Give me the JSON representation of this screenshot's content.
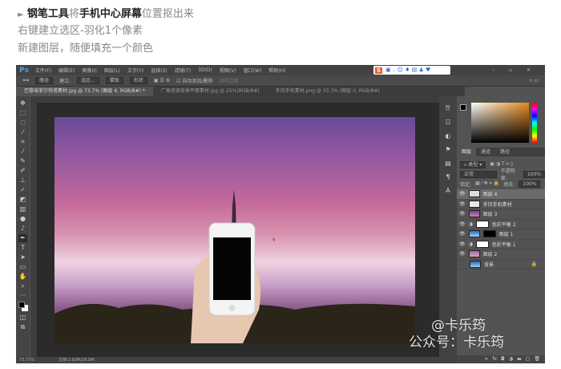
{
  "article": {
    "line1_arrow": "►",
    "line1_bold1": "钢笔工具",
    "line1_plain1": "将",
    "line1_bold2": "手机中心屏幕",
    "line1_plain2": "位置抠出来",
    "line2": "右键建立选区-羽化1个像素",
    "line3": "新建图层，随便填充一个颜色"
  },
  "ps": {
    "logo": "Ps",
    "menu": [
      "文件(F)",
      "编辑(E)",
      "图像(I)",
      "图层(L)",
      "文字(Y)",
      "选择(S)",
      "滤镜(T)",
      "3D(D)",
      "视图(V)",
      "窗口(W)",
      "帮助(H)"
    ],
    "options": {
      "mode": "路径",
      "make": "建立:",
      "selection": "选区...",
      "mask": "蒙版",
      "shape": "形状",
      "auto_add": "自动添加/删除",
      "align": "对齐边缘"
    },
    "tabs": [
      "巴黎埃菲尔铁塔素材.jpg @ 73.7% (图层 4, RGB/8#) *",
      "广角资源背景平面素材.jpg @ 25%(RGB/8#)",
      "手持手机素材.png @ 33.3% (图层 0, RGB/8#)"
    ],
    "status": {
      "zoom": "73.73%",
      "doc": "文档:2.92M/28.0M"
    },
    "panel_tabs": [
      "图层",
      "通道",
      "路径"
    ],
    "kind": "类型",
    "blend": "正常",
    "opacity_label": "不透明度:",
    "opacity": "100%",
    "lock_label": "锁定:",
    "fill_label": "填充:",
    "fill": "100%",
    "layers": [
      {
        "name": "图层 4",
        "selected": true
      },
      {
        "name": "手持手机素材"
      },
      {
        "name": "图层 3"
      },
      {
        "name": "色彩平衡 2",
        "adjust": true
      },
      {
        "name": "图层 1"
      },
      {
        "name": "色彩平衡 1",
        "adjust": true
      },
      {
        "name": "图层 2"
      },
      {
        "name": "背景",
        "locked": true
      }
    ]
  },
  "watermark": {
    "line1": "@卡乐筠",
    "line2": "公众号：卡乐筠"
  }
}
